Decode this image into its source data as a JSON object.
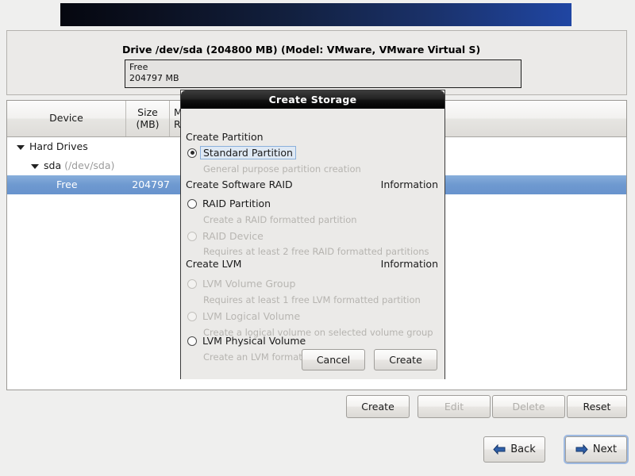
{
  "banner": {
    "name": "header-banner"
  },
  "drive_panel": {
    "title": "Drive /dev/sda (204800 MB) (Model: VMware, VMware Virtual S)",
    "segment": {
      "label": "Free",
      "size": "204797 MB"
    }
  },
  "tree": {
    "columns": [
      {
        "label": "Device"
      },
      {
        "label": "Size\n(MB)"
      },
      {
        "label": "Mount Point/\nRAID/Volume"
      }
    ],
    "column_device": "Device",
    "column_size_line1": "Size",
    "column_size_line2": "(MB)",
    "column_mount_line1": "M",
    "column_mount_line2": "R",
    "rows": [
      {
        "name": "Hard Drives",
        "path": "",
        "size": "",
        "selected": false,
        "depth": 0
      },
      {
        "name": "sda",
        "path": "(/dev/sda)",
        "size": "",
        "selected": false,
        "depth": 1
      },
      {
        "name": "Free",
        "path": "",
        "size": "204797",
        "selected": true,
        "depth": 2
      }
    ]
  },
  "actions": {
    "create": "Create",
    "edit": "Edit",
    "delete": "Delete",
    "reset": "Reset"
  },
  "nav": {
    "back": "Back",
    "next": "Next"
  },
  "dialog": {
    "title": "Create Storage",
    "sections": {
      "partition_heading": "Create Partition",
      "raid_heading": "Create Software RAID",
      "raid_info": "Information",
      "lvm_heading": "Create LVM",
      "lvm_info": "Information"
    },
    "options": [
      {
        "label": "Standard Partition",
        "hint": "General purpose partition creation",
        "selected": true,
        "enabled": true
      },
      {
        "label": "RAID Partition",
        "hint": "Create a RAID formatted partition",
        "selected": false,
        "enabled": true
      },
      {
        "label": "RAID Device",
        "hint": "Requires at least 2 free RAID formatted partitions",
        "selected": false,
        "enabled": false
      },
      {
        "label": "LVM Volume Group",
        "hint": "Requires at least 1 free LVM formatted partition",
        "selected": false,
        "enabled": false
      },
      {
        "label": "LVM Logical Volume",
        "hint": "Create a logical volume on selected volume group",
        "selected": false,
        "enabled": false
      },
      {
        "label": "LVM Physical Volume",
        "hint": "Create an LVM formatted partition",
        "selected": false,
        "enabled": true
      }
    ],
    "buttons": {
      "cancel": "Cancel",
      "create": "Create"
    }
  },
  "colors": {
    "selection_blue": "#6e99d0",
    "banner_dark": "#05070f",
    "banner_light": "#2046a3",
    "panel_bg": "#ebeae8",
    "disabled_text": "#b6b4b0"
  }
}
